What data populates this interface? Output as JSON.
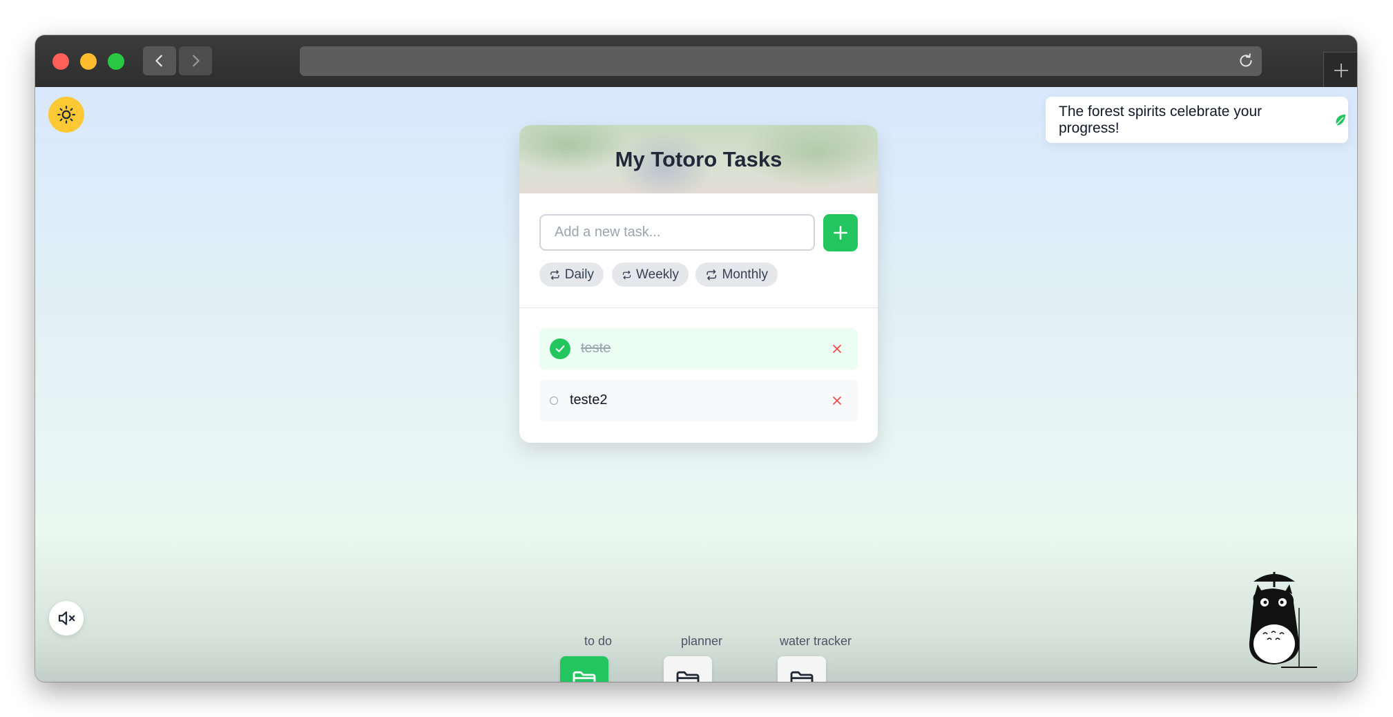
{
  "header": {
    "title": "My Totoro Tasks"
  },
  "input": {
    "placeholder": "Add a new task...",
    "value": ""
  },
  "filters": [
    {
      "label": "Daily",
      "icon": "repeat-icon"
    },
    {
      "label": "Weekly",
      "icon": "repeat-icon"
    },
    {
      "label": "Monthly",
      "icon": "repeat-icon"
    }
  ],
  "tasks": [
    {
      "text": "teste",
      "done": true
    },
    {
      "text": "teste2",
      "done": false
    }
  ],
  "toast": {
    "message": "The forest spirits celebrate your progress!",
    "icon": "leaf-icon"
  },
  "dock": [
    {
      "label": "to do",
      "active": true
    },
    {
      "label": "planner",
      "active": false
    },
    {
      "label": "water tracker",
      "active": false
    }
  ],
  "colors": {
    "accent": "#22c55e",
    "theme_toggle": "#fcc935",
    "delete": "#ef4444"
  }
}
